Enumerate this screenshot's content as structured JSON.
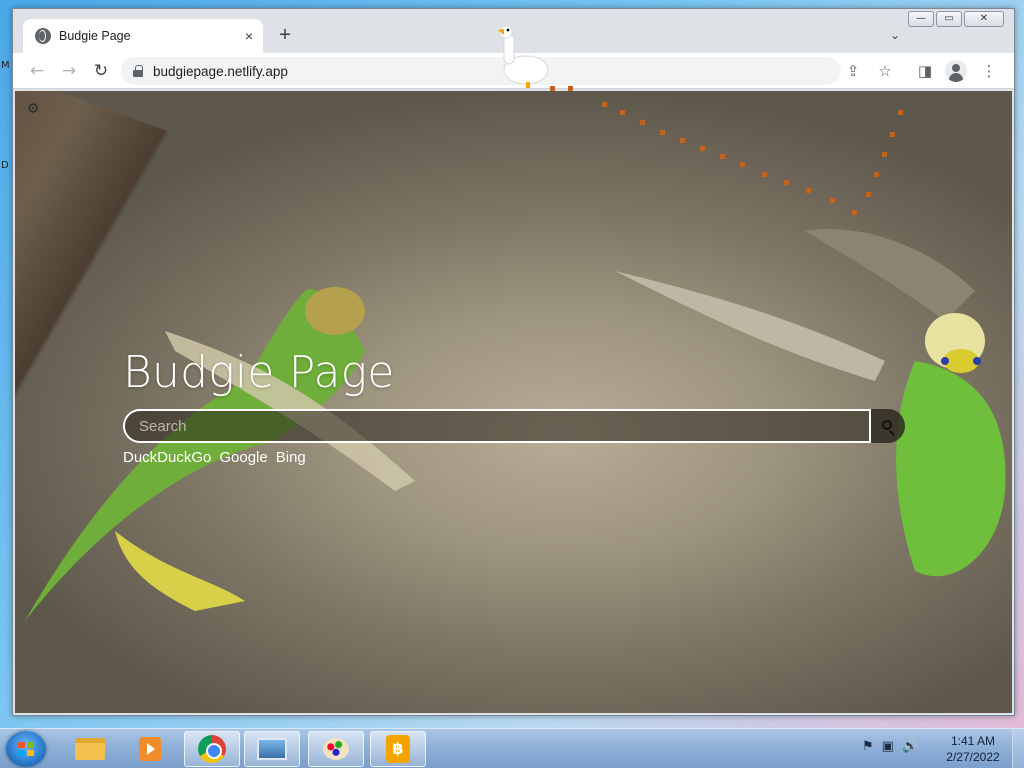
{
  "desktop": {
    "edge_letters": [
      "M",
      "D"
    ]
  },
  "browser": {
    "tab": {
      "title": "Budgie Page",
      "close_glyph": "×"
    },
    "new_tab_glyph": "+",
    "tab_menu_glyph": "⌄",
    "window_controls": {
      "minimize": "—",
      "maximize": "▭",
      "close": "✕"
    },
    "toolbar": {
      "back_glyph": "←",
      "forward_glyph": "→",
      "reload_glyph": "↻",
      "url": "budgiepage.netlify.app",
      "share_glyph": "⇪",
      "bookmark_glyph": "☆",
      "side_panel_glyph": "◨",
      "menu_glyph": "⋮"
    }
  },
  "page": {
    "settings_glyph": "⚙",
    "title": "Budgie Page",
    "search": {
      "placeholder": "Search",
      "value": ""
    },
    "engines": [
      "DuckDuckGo",
      "Google",
      "Bing"
    ],
    "icons": [
      "gear-icon",
      "search-icon"
    ]
  },
  "taskbar": {
    "apps": [
      {
        "name": "File Explorer",
        "icon": "folder-icon"
      },
      {
        "name": "Media Player",
        "icon": "media-player-icon"
      },
      {
        "name": "Google Chrome",
        "icon": "chrome-icon"
      },
      {
        "name": "Photo Viewer",
        "icon": "photo-viewer-icon"
      },
      {
        "name": "Paint",
        "icon": "paint-icon"
      },
      {
        "name": "Budgie",
        "icon": "budgie-icon"
      }
    ],
    "tray": {
      "flag_glyph": "⚑",
      "network_glyph": "▣",
      "volume_glyph": "🔊"
    },
    "clock": {
      "time": "1:41 AM",
      "date": "2/27/2022"
    }
  },
  "colors": {
    "tab_bar": "#dee1e6",
    "page_bg": "#9e957f",
    "brand_text": "#ffffff",
    "trail": "#c4621f"
  }
}
